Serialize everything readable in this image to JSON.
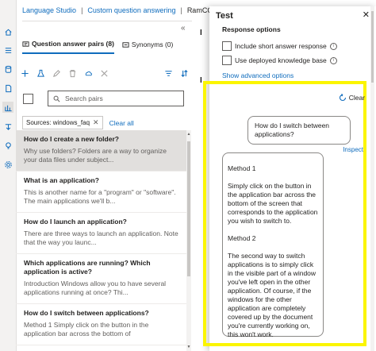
{
  "breadcrumb": {
    "items": [
      "Language Studio",
      "Custom question answering",
      "RamCQA - E"
    ],
    "separator": "|"
  },
  "left_panel": {
    "tabs": [
      {
        "label": "Question answer pairs (8)",
        "active": true
      },
      {
        "label": "Synonyms (0)",
        "active": false
      }
    ],
    "search_placeholder": "Search pairs",
    "filter": {
      "chip": "Sources: windows_faq",
      "clear_label": "Clear all"
    },
    "qna": [
      {
        "question": "How do I create a new folder?",
        "answer": "Why use folders? Folders are a way to organize your data files under subject...",
        "selected": true
      },
      {
        "question": "What is an application?",
        "answer": "This is another name for a \"program\" or \"software\". The main applications we'll b...",
        "selected": false
      },
      {
        "question": "How do I launch an application?",
        "answer": "There are three ways to launch an application. Note that the way you launc...",
        "selected": false
      },
      {
        "question": "Which applications are running? Which application is active?",
        "answer": "Introduction Windows allow you to have several applications running at once? Thi...",
        "selected": false
      },
      {
        "question": "How do I switch between applications?",
        "answer": "Method 1 Simply click on the button in the application bar across the bottom of",
        "selected": false
      }
    ]
  },
  "background": {
    "letter_top": "I",
    "letter_mid": "I"
  },
  "test_panel": {
    "title": "Test",
    "response_options_label": "Response options",
    "include_short_answer_label": "Include short answer response",
    "use_deployed_kb_label": "Use deployed knowledge base",
    "show_advanced_label": "Show advanced options",
    "clear_label": "Clear",
    "user_message": "How do I switch between applications?",
    "inspect_label": "Inspect",
    "bot_response": [
      "Method 1",
      "Simply click on the button in the application bar across the bottom of the screen that corresponds to the application you wish to switch to.",
      "Method 2",
      "The second way to switch applications is to simply click in the visible part of a window you've left open in the other application. Of course, if the windows for the other application are completely covered up by the document you're currently working on, this won't work."
    ]
  },
  "colors": {
    "accent": "#0f6cbd",
    "highlight": "#fbf500",
    "selected_row": "#e1dfdd"
  },
  "icons": [
    "home-icon",
    "list-icon",
    "database-icon",
    "document-icon",
    "analytics-icon",
    "deploy-icon",
    "bulb-icon",
    "settings-icon",
    "qa-pairs-icon",
    "synonyms-icon",
    "add-icon",
    "flask-icon",
    "edit-icon",
    "delete-icon",
    "cloud-icon",
    "close-icon",
    "filter-icon",
    "sort-icon",
    "search-icon",
    "refresh-icon"
  ]
}
